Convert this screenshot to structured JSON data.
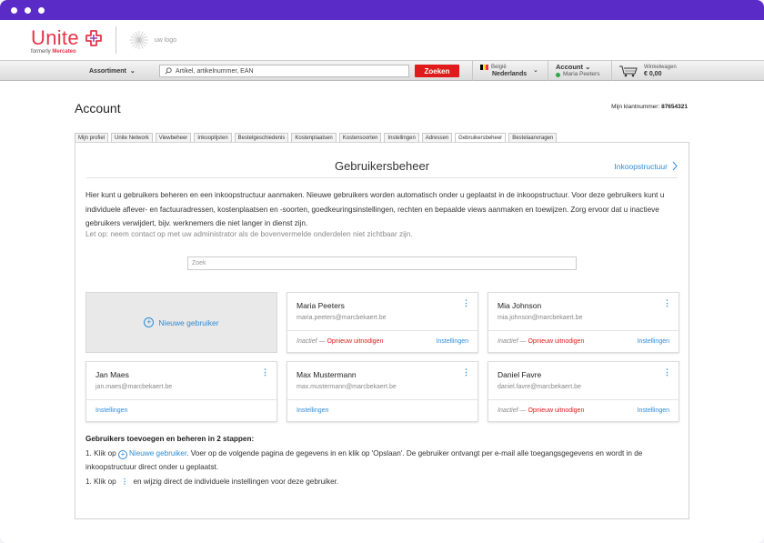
{
  "header": {
    "brand": "Unite",
    "brand_sub_prefix": "formerly",
    "brand_sub_name": "Mercateo",
    "partner_logo_text": "uw logo"
  },
  "nav": {
    "assortiment": "Assortiment",
    "search_placeholder": "Artikel, artikelnummer, EAN",
    "search_button": "Zoeken",
    "country": "België",
    "language": "Nederlands",
    "account_label": "Account",
    "account_user": "Maria Peeters",
    "cart_label": "Winkelwagen",
    "cart_total": "€ 0,00"
  },
  "page": {
    "title": "Account",
    "customer_number_label": "Mijn klantnummer:",
    "customer_number": "87654321"
  },
  "tabs": [
    "Mijn profiel",
    "Unite Network",
    "Viewbeheer",
    "Inkooplijsten",
    "Bestelgeschiedenis",
    "Kostenplaatsen",
    "Kostensoorten",
    "Instellingen",
    "Adressen",
    "Gebruikersbeheer",
    "Bestelaanvragen"
  ],
  "panel": {
    "title": "Gebruikersbeheer",
    "link": "Inkoopstructuur",
    "intro": "Hier kunt u gebruikers beheren en een inkoopstructuur aanmaken. Nieuwe gebruikers worden automatisch onder u geplaatst in de inkoopstructuur. Voor deze gebruikers kunt u individuele aflever- en factuuradressen, kostenplaatsen en -soorten, goedkeuringsinstellingen, rechten en bepaalde views aanmaken en toewijzen. Zorg ervoor dat u inactieve gebruikers verwijdert, bijv. werknemers die niet langer in dienst zijn.",
    "note": "Let op: neem contact op met uw administrator als de bovenvermelde onderdelen niet zichtbaar zijn.",
    "search_placeholder": "Zoek",
    "new_user": "Nieuwe gebruiker"
  },
  "users": [
    {
      "name": "Maria Peeters",
      "email": "maria.peeters@marcbekaert.be",
      "status": "Inactief —",
      "invite": "Opnieuw uitnodigen",
      "settings": "Instellingen"
    },
    {
      "name": "Mia Johnson",
      "email": "mia.johnson@marcbekaert.be",
      "status": "Inactief —",
      "invite": "Opnieuw uitnodigen",
      "settings": "Instellingen"
    },
    {
      "name": "Jan Maes",
      "email": "jan.maes@marcbekaert.be",
      "status": "",
      "invite": "",
      "settings": "Instellingen"
    },
    {
      "name": "Max Mustermann",
      "email": "max.mustermann@marcbekaert.be",
      "status": "",
      "invite": "",
      "settings": "Instellingen"
    },
    {
      "name": "Daniel Favre",
      "email": "daniel.favre@marcbekaert.be",
      "status": "Inactief —",
      "invite": "Opnieuw uitnodigen",
      "settings": "Instellingen"
    }
  ],
  "steps": {
    "heading": "Gebruikers toevoegen en beheren in 2 stappen:",
    "step1_prefix": "1. Klik op",
    "step1_link": "Nieuwe gebruiker",
    "step1_rest": ". Voer op de volgende pagina de gegevens in en klik op 'Opslaan'. De gebruiker ontvangt per e-mail alle toegangsgegevens en wordt in de inkoopstructuur direct onder u geplaatst.",
    "step2_prefix": "1. Klik op",
    "step2_rest": "en wijzig direct de individuele instellingen voor deze gebruiker."
  },
  "colors": {
    "titlebar": "#5b2bc7",
    "brand_red": "#e4364a",
    "link_blue": "#2e8bd6",
    "search_button": "#e01b1b"
  }
}
